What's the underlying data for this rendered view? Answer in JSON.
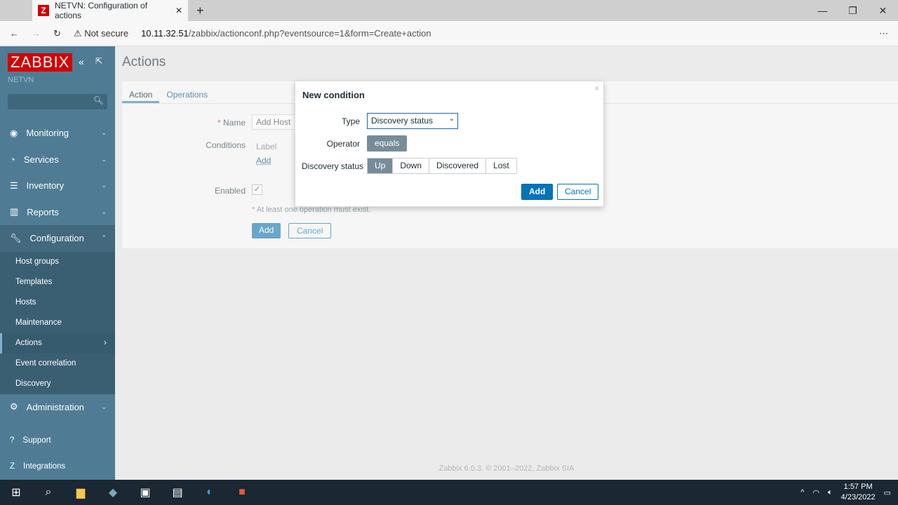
{
  "browser": {
    "tab_title": "NETVN: Configuration of actions",
    "security": "Not secure",
    "url_host": "10.11.32.51",
    "url_path": "/zabbix/actionconf.php?eventsource=1&form=Create+action"
  },
  "sidebar": {
    "logo": "ZABBIX",
    "server": "NETVN",
    "items": [
      {
        "label": "Monitoring"
      },
      {
        "label": "Services"
      },
      {
        "label": "Inventory"
      },
      {
        "label": "Reports"
      },
      {
        "label": "Configuration"
      }
    ],
    "sub_items": [
      {
        "label": "Host groups"
      },
      {
        "label": "Templates"
      },
      {
        "label": "Hosts"
      },
      {
        "label": "Maintenance"
      },
      {
        "label": "Actions"
      },
      {
        "label": "Event correlation"
      },
      {
        "label": "Discovery"
      }
    ],
    "admin": "Administration",
    "support": "Support",
    "integrations": "Integrations"
  },
  "page": {
    "title": "Actions",
    "tabs": [
      "Action",
      "Operations"
    ],
    "name_label": "Name",
    "name_value": "Add Host",
    "conditions_label": "Conditions",
    "conditions_col": "Label",
    "conditions_add": "Add",
    "enabled_label": "Enabled",
    "note": "* At least one operation must exist.",
    "add": "Add",
    "cancel": "Cancel",
    "footer": "Zabbix 6.0.3. © 2001–2022, Zabbix SIA"
  },
  "dialog": {
    "title": "New condition",
    "type_label": "Type",
    "type_value": "Discovery status",
    "operator_label": "Operator",
    "operator_value": "equals",
    "status_label": "Discovery status",
    "statuses": [
      "Up",
      "Down",
      "Discovered",
      "Lost"
    ],
    "selected": "Up",
    "add": "Add",
    "cancel": "Cancel"
  },
  "taskbar": {
    "time": "1:57 PM",
    "date": "4/23/2022"
  }
}
